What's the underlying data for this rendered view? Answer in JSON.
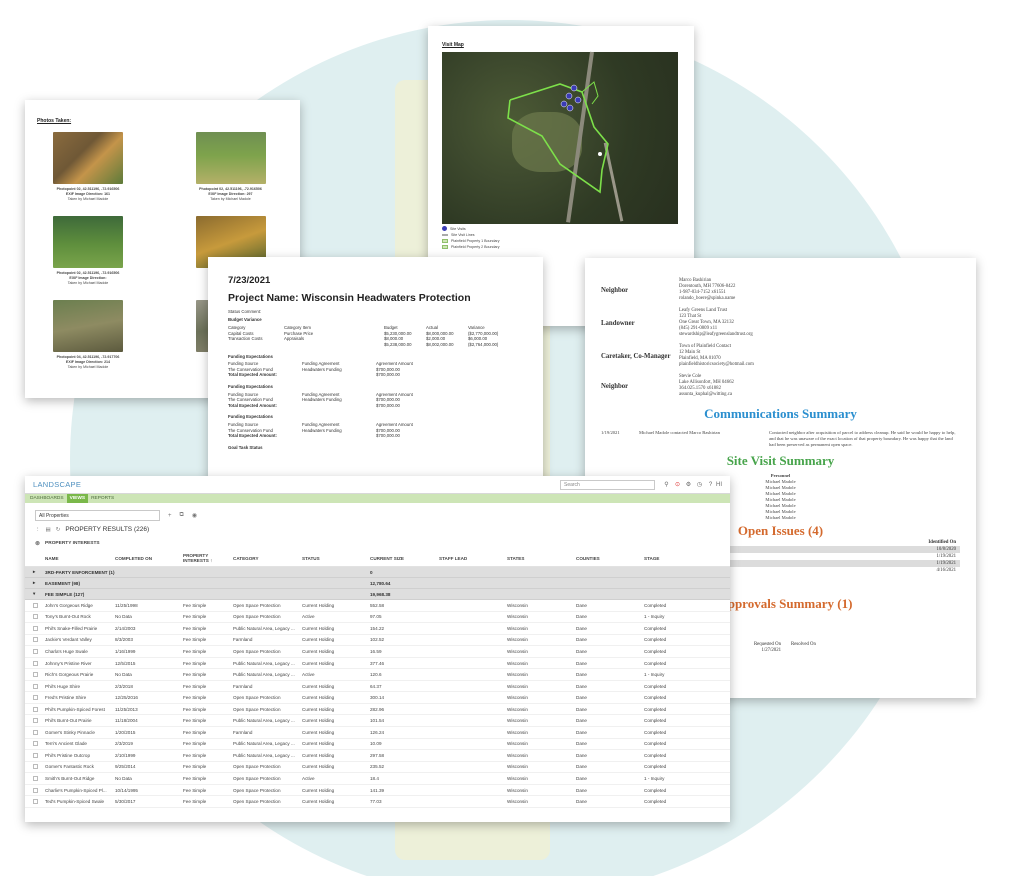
{
  "photos_doc": {
    "title": "Photos Taken:",
    "items": [
      {
        "line1": "Photopoint 02, 42.511196, -72.916506",
        "line2": "EXIF Image Direction: 161",
        "line3": "Taken by Michael Madole"
      },
      {
        "line1": "Photopoint 02, 42.511196, -72.916506",
        "line2": "EXIF Image Direction: 297",
        "line3": "Taken by Michael Madole"
      },
      {
        "line1": "Photopoint 02, 42.511196, -72.916506",
        "line2": "EXIF Image Direction:",
        "line3": "Taken by Michael Madole"
      },
      {
        "line1": "Photopoint",
        "line2": "",
        "line3": "Taken"
      },
      {
        "line1": "Photopoint 04, 42.511196, -72.917706",
        "line2": "EXIF Image Direction: 214",
        "line3": "Taken by Michael Madole"
      },
      {
        "line1": "Photopoint",
        "line2": "",
        "line3": "Taken"
      }
    ]
  },
  "map_doc": {
    "title": "Visit Map",
    "legend": [
      "Site Visits",
      "Site Visit Lines",
      "Plainfield Property 1 Boundary",
      "Plainfield Property 2 Boundary"
    ]
  },
  "project_doc": {
    "date": "7/23/2021",
    "name": "Project Name: Wisconsin Headwaters Protection",
    "status_comment": "Status Comment:",
    "budget_variance": "Budget Variance",
    "budget_headers": [
      "Category",
      "Category Item",
      "Budget",
      "Actual",
      "Variance"
    ],
    "budget_rows": [
      [
        "Capital Costs",
        "Purchase Price",
        "$5,230,000.00",
        "$8,000,000.00",
        "($2,770,000.00)"
      ],
      [
        "Transaction Costs",
        "Appraisals",
        "$8,000.00",
        "$2,000.00",
        "$6,000.00"
      ],
      [
        "",
        "",
        "$5,238,000.00",
        "$8,002,000.00",
        "($2,764,000.00)"
      ]
    ],
    "funding_title": "Funding Expectations",
    "funding_headers": [
      "Funding Source",
      "Funding Agreement",
      "Agreement Amount"
    ],
    "funding_row": [
      "The Conservation Fund",
      "Headwaters Funding",
      "$700,000.00"
    ],
    "funding_total_label": "Total Expected Amount:",
    "funding_total": "$700,000.00",
    "goal_status": "Goal Task Status"
  },
  "report_doc": {
    "contacts": [
      {
        "role": "Neighbor",
        "lines": [
          "Marco Bashirian",
          "Dorentouth, MH 77606-8422",
          "1-987-034-7152 x61551",
          "rolando_boere@spinka.name"
        ]
      },
      {
        "role": "Landowner",
        "lines": [
          "Leafy Greens Land Trust",
          "123 That St",
          "One Great Town, MA 32132",
          "(845) 291-0809 x11",
          "stewardship@leafygreenslandtrust.org"
        ]
      },
      {
        "role": "Caretaker, Co-Manager",
        "lines": [
          "Town of Plainfield Contact",
          "12 Main St",
          "Plainfield, MA 01070",
          "plainfieldhistoricsociety@hotmail.com"
        ]
      },
      {
        "role": "Neighbor",
        "lines": [
          "Stevie Cole",
          "Lake Allisonfort, MH 04662",
          "364.025.1570 x61882",
          "assunta_kuphal@witting.ca"
        ]
      }
    ],
    "comm_title": "Communications Summary",
    "comm_date": "1/19/2021",
    "comm_party": "Michael Madole contacted Marco Bashirian",
    "comm_text": "Contacted neighbor after acquisition of parcel to address cleanup. He said he would be happy to help, and that he was unaware of the exact location of that property boundary. He was happy that the land had been preserved as permanent open space.",
    "site_title": "Site Visit Summary",
    "personnel_label": "Personnel",
    "personnel": [
      "Michael Madole",
      "Michael Madole",
      "Michael Madole",
      "Michael Madole",
      "Michael Madole",
      "Michael Madole",
      "Michael Madole"
    ],
    "issues_title": "Open Issues (4)",
    "identified_label": "Identified On",
    "issue_dates": [
      "10/8/2020",
      "1/19/2021",
      "1/19/2021",
      "4/16/2021"
    ],
    "approvals_title": "d Approvals Summary (1)",
    "requested_label": "Requested On",
    "resolved_label": "Resolved On",
    "requested_date": "1/27/2021"
  },
  "app": {
    "logo": "LANDSCAPE",
    "search_placeholder": "Search",
    "hm_label": "HI",
    "nav": [
      "DASHBOARDS",
      "VIEWS",
      "REPORTS"
    ],
    "filter": "All Properties",
    "results_label": "PROPERTY RESULTS (226)",
    "interests_label": "PROPERTY INTERESTS",
    "columns": [
      "NAME",
      "COMPLETED ON",
      "PROPERTY INTERESTS",
      "CATEGORY",
      "STATUS",
      "CURRENT SIZE",
      "STAFF LEAD",
      "STATES",
      "COUNTIES",
      "STAGE"
    ],
    "groups": [
      {
        "label": "3RD-PARTY ENFORCEMENT (1)",
        "size": "0"
      },
      {
        "label": "EASEMENT (98)",
        "size": "12,780.64"
      },
      {
        "label": "FEE SIMPLE (127)",
        "size": "19,968.38"
      }
    ],
    "rows": [
      [
        "John's Gorgeous Ridge",
        "11/25/1998",
        "Fee Simple",
        "Open Space Protection",
        "Current Holding",
        "552.58",
        "",
        "Wisconsin",
        "Dane",
        "Completed"
      ],
      [
        "Tony's Burnt-Out Rock",
        "No Data",
        "Fee Simple",
        "Open Space Protection",
        "Active",
        "97.05",
        "",
        "Wisconsin",
        "Dane",
        "1 - Inquiry"
      ],
      [
        "Phil's Snake-Filled Prairie",
        "2/14/2003",
        "Fee Simple",
        "Public Natural Area, Legacy ...",
        "Current Holding",
        "154.22",
        "",
        "Wisconsin",
        "Dane",
        "Completed"
      ],
      [
        "Jackie's Verdant Valley",
        "8/3/2003",
        "Fee Simple",
        "Farmland",
        "Current Holding",
        "102.52",
        "",
        "Wisconsin",
        "Dane",
        "Completed"
      ],
      [
        "Charla's Huge Swale",
        "1/16/1999",
        "Fee Simple",
        "Open Space Protection",
        "Current Holding",
        "16.59",
        "",
        "Wisconsin",
        "Dane",
        "Completed"
      ],
      [
        "Johnny's Pristine River",
        "12/5/2015",
        "Fee Simple",
        "Public Natural Area, Legacy ...",
        "Current Holding",
        "377.46",
        "",
        "Wisconsin",
        "Dane",
        "Completed"
      ],
      [
        "Rich's Gorgeous Prairie",
        "No Data",
        "Fee Simple",
        "Public Natural Area, Legacy ...",
        "Active",
        "120.6",
        "",
        "Wisconsin",
        "Dane",
        "1 - Inquiry"
      ],
      [
        "Phil's Huge Shire",
        "2/3/2018",
        "Fee Simple",
        "Farmland",
        "Current Holding",
        "64.37",
        "",
        "Wisconsin",
        "Dane",
        "Completed"
      ],
      [
        "Fred's Pristine Shire",
        "12/25/2016",
        "Fee Simple",
        "Open Space Protection",
        "Current Holding",
        "300.14",
        "",
        "Wisconsin",
        "Dane",
        "Completed"
      ],
      [
        "Phil's Pumpkin-Spiced Forest",
        "11/25/2013",
        "Fee Simple",
        "Open Space Protection",
        "Current Holding",
        "282.96",
        "",
        "Wisconsin",
        "Dane",
        "Completed"
      ],
      [
        "Phil's Burnt-Out Prairie",
        "11/18/2004",
        "Fee Simple",
        "Public Natural Area, Legacy ...",
        "Current Holding",
        "101.54",
        "",
        "Wisconsin",
        "Dane",
        "Completed"
      ],
      [
        "Gomer's Stinky Pinnacle",
        "1/20/2015",
        "Fee Simple",
        "Farmland",
        "Current Holding",
        "126.24",
        "",
        "Wisconsin",
        "Dane",
        "Completed"
      ],
      [
        "Terri's Ancient Glade",
        "2/3/2019",
        "Fee Simple",
        "Public Natural Area, Legacy ...",
        "Current Holding",
        "10.09",
        "",
        "Wisconsin",
        "Dane",
        "Completed"
      ],
      [
        "Phil's Pristine Outcrop",
        "2/10/1999",
        "Fee Simple",
        "Public Natural Area, Legacy ...",
        "Current Holding",
        "297.58",
        "",
        "Wisconsin",
        "Dane",
        "Completed"
      ],
      [
        "Gomer's Fantastic Rock",
        "9/25/2014",
        "Fee Simple",
        "Open Space Protection",
        "Current Holding",
        "235.52",
        "",
        "Wisconsin",
        "Dane",
        "Completed"
      ],
      [
        "Smith's Burnt-Out Ridge",
        "No Data",
        "Fee Simple",
        "Open Space Protection",
        "Active",
        "18.4",
        "",
        "Wisconsin",
        "Dane",
        "1 - Inquiry"
      ],
      [
        "Charlie's Pumpkin-Spiced Pl...",
        "10/14/1995",
        "Fee Simple",
        "Open Space Protection",
        "Current Holding",
        "141.39",
        "",
        "Wisconsin",
        "Dane",
        "Completed"
      ],
      [
        "Ted's Pumpkin-Spiced Swale",
        "5/30/2017",
        "Fee Simple",
        "Open Space Protection",
        "Current Holding",
        "77.03",
        "",
        "Wisconsin",
        "Dane",
        "Completed"
      ]
    ]
  }
}
